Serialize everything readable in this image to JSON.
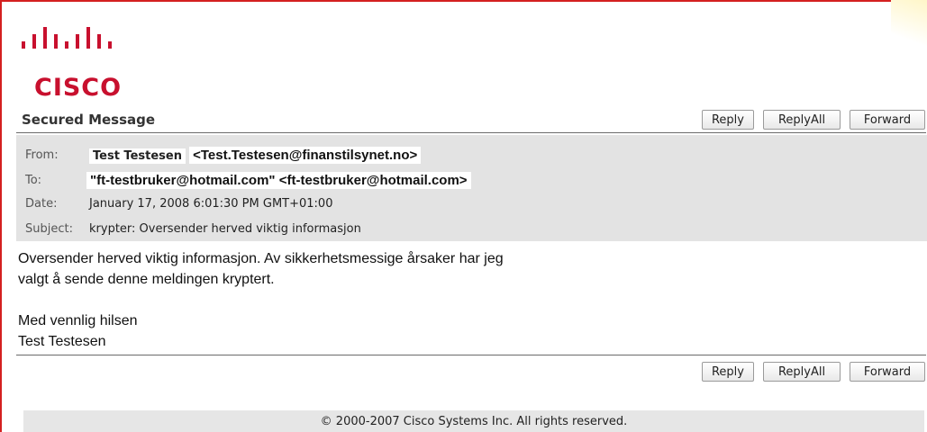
{
  "logo": {
    "wordmark": "CISCO"
  },
  "header": {
    "title": "Secured Message",
    "buttons": {
      "reply": "Reply",
      "reply_all": "ReplyAll",
      "forward": "Forward"
    }
  },
  "meta": {
    "from_label": "From:",
    "from_name": "Test Testesen",
    "from_email": "<Test.Testesen@finanstilsynet.no>",
    "to_label": "To:",
    "to_value": "\"ft-testbruker@hotmail.com\" <ft-testbruker@hotmail.com>",
    "date_label": "Date:",
    "date_value": "January 17, 2008 6:01:30 PM GMT+01:00",
    "subject_label": "Subject:",
    "subject_value": "krypter: Oversender herved viktig informasjon"
  },
  "body": {
    "line1": "Oversender herved viktig informasjon. Av sikkerhetsmessige årsaker har jeg",
    "line2": "valgt å sende denne meldingen kryptert.",
    "line3": "Med vennlig hilsen",
    "line4": "Test Testesen"
  },
  "footer": {
    "copyright": "© 2000-2007 Cisco Systems Inc. All rights reserved."
  },
  "colors": {
    "brand": "#c8102e",
    "panel": "#e3e3e3",
    "frame": "#d42020"
  }
}
